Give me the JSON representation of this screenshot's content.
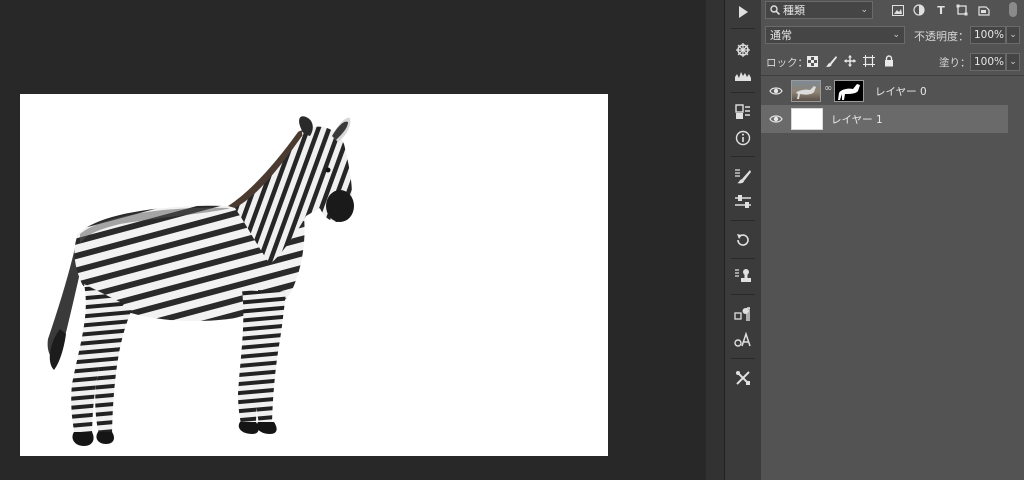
{
  "layers_panel": {
    "filter": {
      "search_icon": "search-icon",
      "value": "種類",
      "icons": [
        "image-filter-icon",
        "adjustment-filter-icon",
        "type-filter-icon",
        "shape-filter-icon",
        "smart-object-filter-icon"
      ],
      "type_glyph": "T"
    },
    "blend_mode": {
      "value": "通常"
    },
    "opacity": {
      "label": "不透明度：",
      "value": "100%"
    },
    "lock": {
      "label": "ロック：",
      "icons": [
        "lock-transparent-icon",
        "lock-paint-icon",
        "lock-position-icon",
        "lock-artboard-icon",
        "lock-all-icon"
      ]
    },
    "fill": {
      "label": "塗り：",
      "value": "100%"
    },
    "layers": [
      {
        "name": "レイヤー 0",
        "visible": true,
        "selected": false,
        "has_mask": true
      },
      {
        "name": "レイヤー 1",
        "visible": true,
        "selected": true,
        "has_mask": false
      }
    ]
  },
  "toolbar": {
    "tools": [
      "play-icon",
      "navigator-icon",
      "histogram-icon",
      "properties-icon",
      "info-icon",
      "brush-presets-icon",
      "adjustments-icon",
      "history-icon",
      "clone-source-icon",
      "paragraph-icon",
      "character-icon",
      "tools-icon"
    ]
  },
  "colors": {
    "canvas_bg": "#282828",
    "panel_bg": "#535353",
    "selected_row": "#6a6a6a",
    "document_bg": "#ffffff"
  }
}
